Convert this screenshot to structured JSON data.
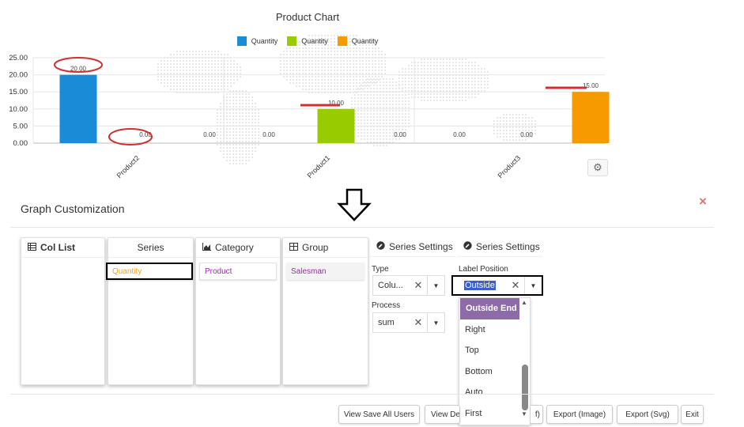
{
  "chart_data": {
    "type": "bar",
    "title": "Product Chart",
    "legend": [
      "Quantity",
      "Quantity",
      "Quantity"
    ],
    "legend_colors": [
      "#1a8bd6",
      "#99cc00",
      "#f59b00"
    ],
    "legend_position": "top-center",
    "categories": [
      "Product2",
      "Product1",
      "Product3"
    ],
    "series": [
      {
        "name": "Quantity",
        "color": "#1a8bd6",
        "values": [
          20.0,
          0.0,
          0.0
        ]
      },
      {
        "name": "Quantity",
        "color": "#99cc00",
        "values": [
          0.0,
          10.0,
          0.0
        ]
      },
      {
        "name": "Quantity",
        "color": "#f59b00",
        "values": [
          0.0,
          0.0,
          15.0
        ]
      }
    ],
    "data_labels": [
      [
        "20.00",
        "0.00",
        "0.00"
      ],
      [
        "0.00",
        "10.00",
        "0.00"
      ],
      [
        "0.00",
        "0.00",
        "15.00"
      ]
    ],
    "y_ticks": [
      "25.00",
      "20.00",
      "15.00",
      "10.00",
      "5.00",
      "0.00"
    ],
    "ylim": [
      0,
      25
    ],
    "grid": true
  },
  "panel": {
    "title": "Graph Customization",
    "close": "×"
  },
  "columns": {
    "col_list": {
      "header": "Col List",
      "icon": "table-icon"
    },
    "series": {
      "header": "Series",
      "chip": "Quantity",
      "chip_color": "#f0a020"
    },
    "category": {
      "header": "Category",
      "icon": "area-chart-icon",
      "chip": "Product",
      "chip_color": "#9c27b0"
    },
    "group": {
      "header": "Group",
      "icon": "table-icon",
      "chip": "Salesman",
      "chip_color": "#9c27b0"
    }
  },
  "settings_1": {
    "header": "Series Settings",
    "type_label": "Type",
    "type_value": "Colu...",
    "process_label": "Process",
    "process_value": "sum"
  },
  "settings_2": {
    "header": "Series Settings",
    "label_position_label": "Label Position",
    "label_position_value": "Outside",
    "options": [
      "Outside End",
      "Right",
      "Top",
      "Bottom",
      "Auto",
      "First"
    ],
    "selected_option": "Outside End"
  },
  "buttons": {
    "view_save_all_users": "View Save All Users",
    "view_de": "View De",
    "hidden_f": "f)",
    "export_image": "Export (Image)",
    "export_svg": "Export (Svg)",
    "exit": "Exit"
  },
  "colors": {
    "accent_purple": "#8e6aa8",
    "close_red": "#e57373",
    "annotation_red": "#d32f2f"
  }
}
